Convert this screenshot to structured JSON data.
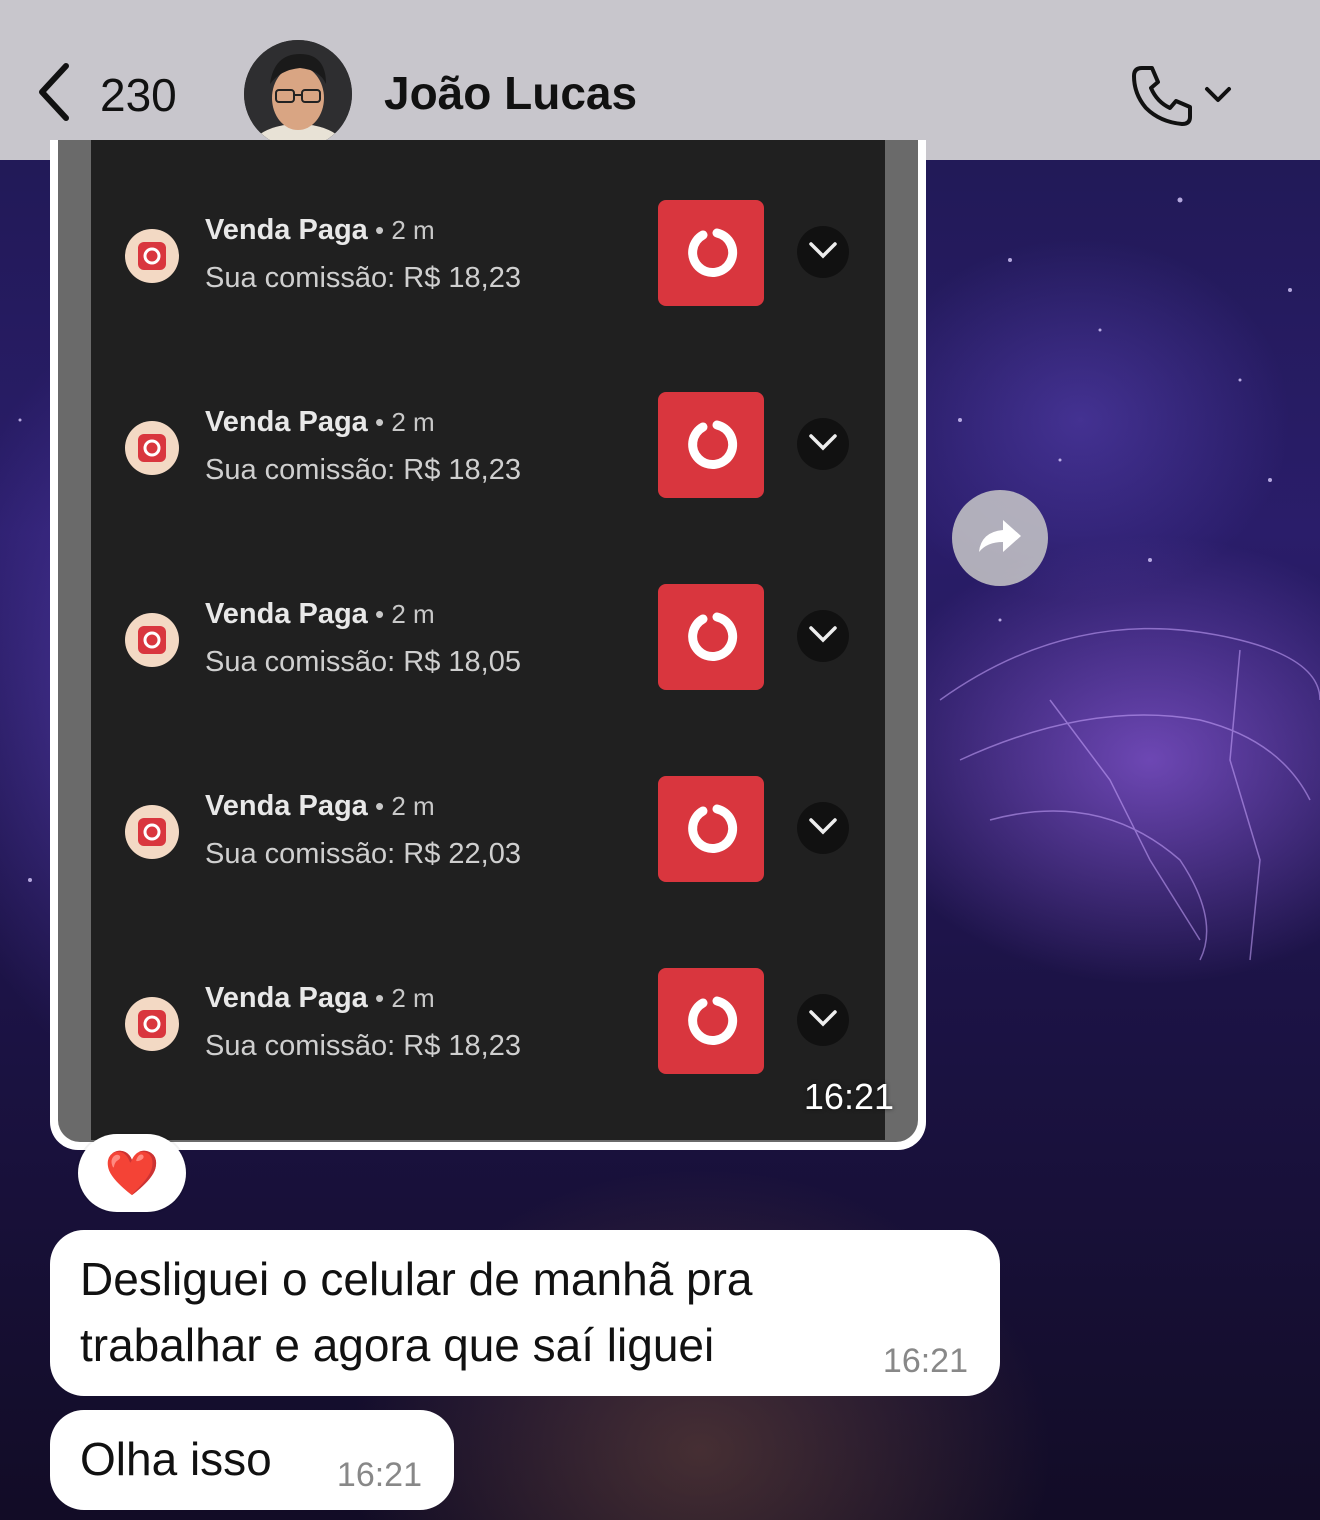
{
  "header": {
    "back_count": "230",
    "contact_name": "João Lucas"
  },
  "image_message": {
    "notifications": [
      {
        "title": "Venda Paga",
        "age": "2 m",
        "body": "Sua comissão: R$ 18,23"
      },
      {
        "title": "Venda Paga",
        "age": "2 m",
        "body": "Sua comissão: R$ 18,23"
      },
      {
        "title": "Venda Paga",
        "age": "2 m",
        "body": "Sua comissão: R$ 18,05"
      },
      {
        "title": "Venda Paga",
        "age": "2 m",
        "body": "Sua comissão: R$ 22,03"
      },
      {
        "title": "Venda Paga",
        "age": "2 m",
        "body": "Sua comissão: R$ 18,23"
      }
    ],
    "time": "16:21",
    "reaction": "❤️"
  },
  "messages": [
    {
      "line1": "Desliguei o celular de manhã pra",
      "line2": "trabalhar e agora que saí liguei",
      "time": "16:21"
    },
    {
      "text": "Olha isso",
      "time": "16:21"
    }
  ],
  "colors": {
    "header_bg": "#c8c6cc",
    "app_red": "#d9363e",
    "bubble_bg": "#ffffff",
    "notification_bg": "#202020"
  },
  "icons": {
    "back": "chevron-left-icon",
    "call": "phone-icon",
    "call_menu": "chevron-down-icon",
    "forward": "forward-arrow-icon",
    "expand": "chevron-down-icon"
  }
}
